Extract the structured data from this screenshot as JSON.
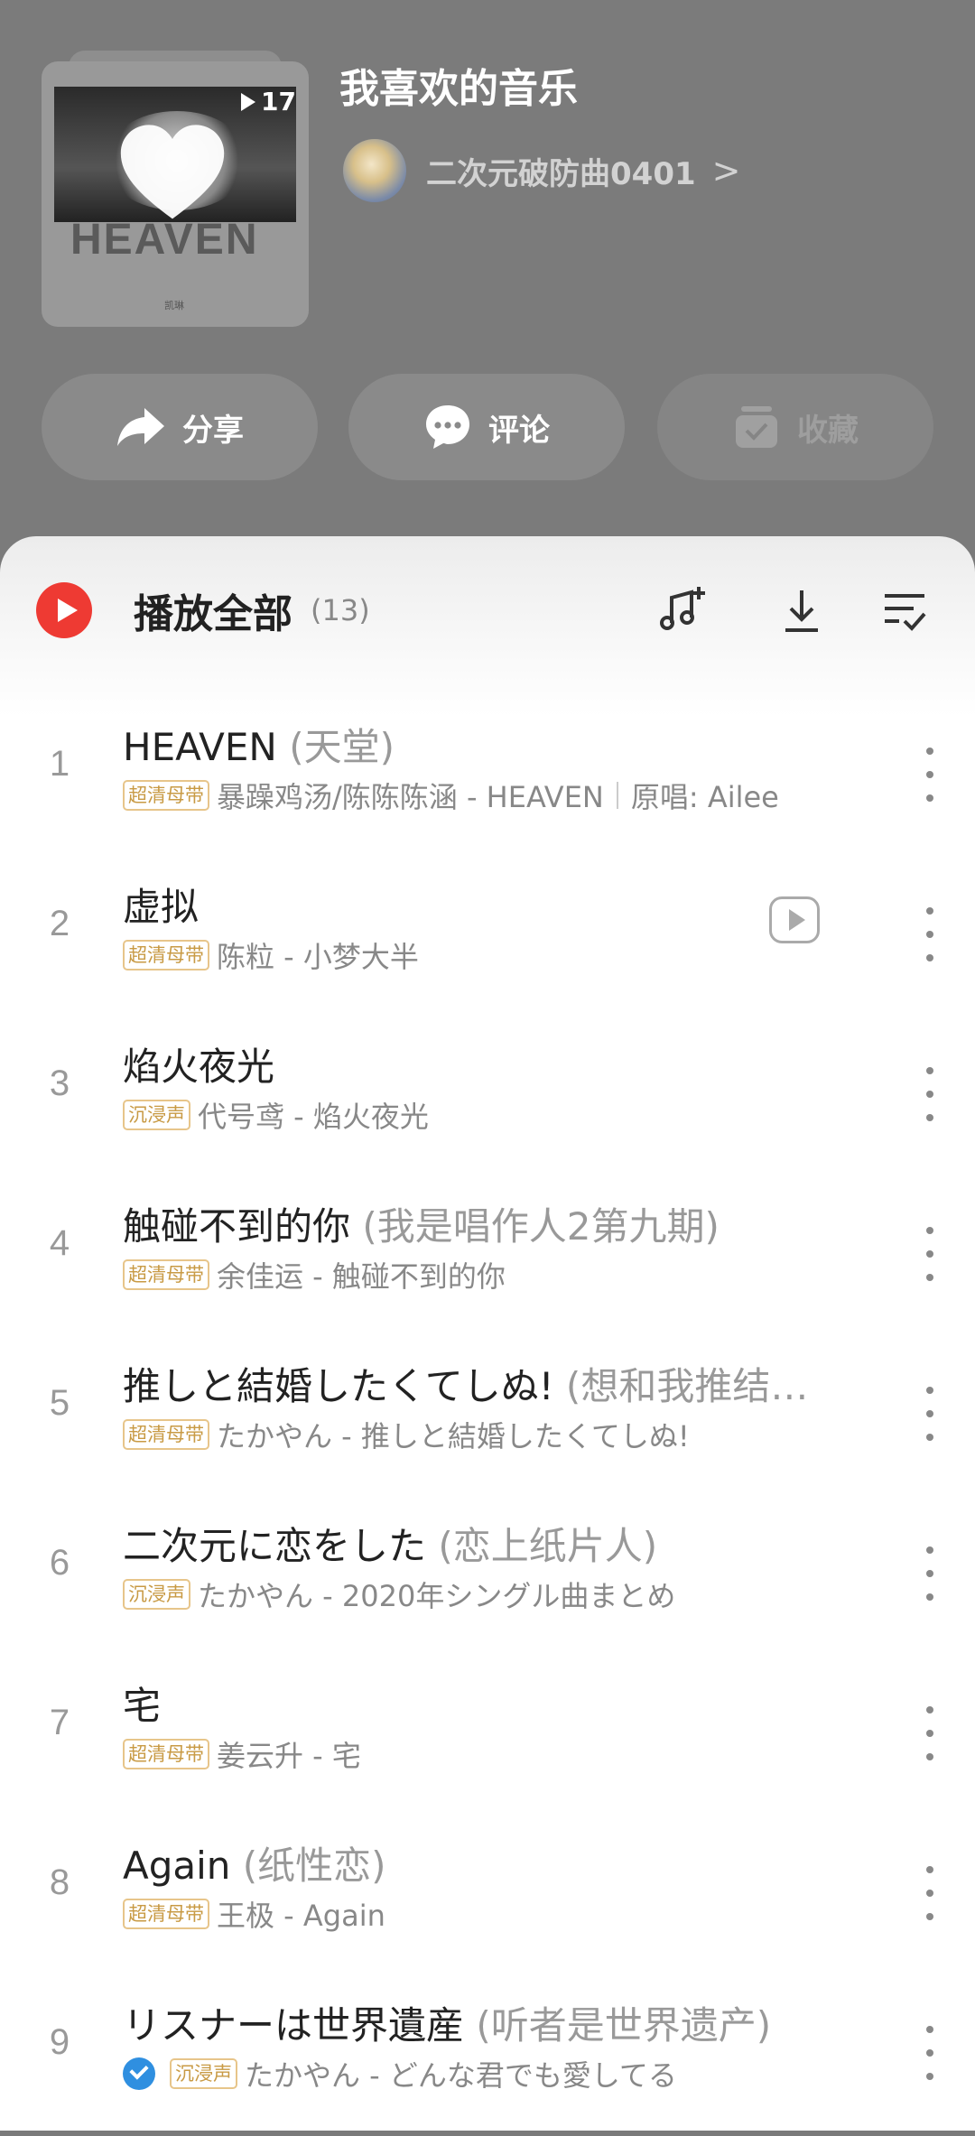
{
  "playlist": {
    "title": "我喜欢的音乐",
    "play_count": "17",
    "cover_text": "HEAVEN",
    "cover_small_text": "凯琳",
    "creator": {
      "name": "二次元破防曲0401",
      "chevron": ">"
    }
  },
  "actions": {
    "share": "分享",
    "comment": "评论",
    "collect": "收藏"
  },
  "list_header": {
    "play_all": "播放全部",
    "count": "(13)"
  },
  "tracks": [
    {
      "index": "1",
      "title": "HEAVEN",
      "alias": " (天堂)",
      "tag": "超清母带",
      "artists_album": "暴躁鸡汤/陈陈陈涵 - HEAVEN",
      "original": "原唱: Ailee"
    },
    {
      "index": "2",
      "title": "虚拟",
      "alias": "",
      "tag": "超清母带",
      "artists_album": "陈粒 - 小梦大半",
      "has_mv": true
    },
    {
      "index": "3",
      "title": "焰火夜光",
      "alias": "",
      "tag": "沉浸声",
      "artists_album": "代号鸢 - 焰火夜光"
    },
    {
      "index": "4",
      "title": "触碰不到的你",
      "alias": " (我是唱作人2第九期)",
      "tag": "超清母带",
      "artists_album": "余佳运 - 触碰不到的你"
    },
    {
      "index": "5",
      "title": "推しと結婚したくてしぬ!",
      "alias": " (想和我推结…",
      "tag": "超清母带",
      "artists_album": "たかやん - 推しと結婚したくてしぬ!"
    },
    {
      "index": "6",
      "title": "二次元に恋をした",
      "alias": " (恋上纸片人)",
      "tag": "沉浸声",
      "artists_album": "たかやん - 2020年シングル曲まとめ"
    },
    {
      "index": "7",
      "title": "宅",
      "alias": "",
      "tag": "超清母带",
      "artists_album": "姜云升 - 宅"
    },
    {
      "index": "8",
      "title": "Again",
      "alias": " (纸性恋)",
      "tag": "超清母带",
      "artists_album": "王极 - Again"
    },
    {
      "index": "9",
      "title": "リスナーは世界遺産",
      "alias": " (听者是世界遗产)",
      "tag": "沉浸声",
      "artists_album": "たかやん - どんな君でも愛してる",
      "downloaded": true
    }
  ],
  "colors": {
    "accent": "#ee3a33",
    "tag": "#c89a44",
    "header_bg": "#7b7b7b"
  }
}
